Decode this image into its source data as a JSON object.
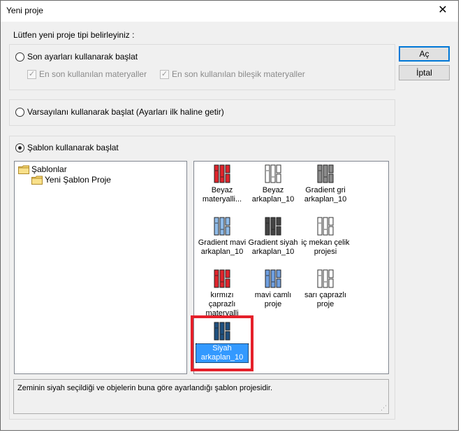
{
  "window": {
    "title": "Yeni proje",
    "close_glyph": "✕"
  },
  "prompt": "Lütfen yeni proje tipi belirleyiniz :",
  "option_recent": {
    "label": "Son ayarları kullanarak başlat",
    "checked": false,
    "checkbox_materials": "En son kullanılan materyaller",
    "checkbox_composite": "En son kullanılan bileşik materyaller"
  },
  "option_default": {
    "label": "Varsayılanı kullanarak başlat (Ayarları ilk haline getir)",
    "checked": false
  },
  "option_template": {
    "label": "Şablon kullanarak başlat",
    "checked": true
  },
  "buttons": {
    "ok": "Aç",
    "cancel": "İptal"
  },
  "tree": {
    "root": "Şablonlar",
    "child": "Yeni Şablon Proje"
  },
  "templates": [
    {
      "label1": "Beyaz",
      "label2": "materyalli...",
      "icon": "red-template-icon",
      "color": "#e0242c",
      "selected": false
    },
    {
      "label1": "Beyaz",
      "label2": "arkaplan_10",
      "icon": "white-template-icon",
      "color": "#ffffff",
      "selected": false
    },
    {
      "label1": "Gradient gri",
      "label2": "arkaplan_10",
      "icon": "gray-template-icon",
      "color": "#8c8c8c",
      "selected": false
    },
    {
      "label1": "Gradient mavi",
      "label2": "arkaplan_10",
      "icon": "lightblue-template-icon",
      "color": "#8fbbe8",
      "selected": false
    },
    {
      "label1": "Gradient siyah",
      "label2": "arkaplan_10",
      "icon": "black-template-icon",
      "color": "#444444",
      "selected": false
    },
    {
      "label1": "iç mekan çelik",
      "label2": "projesi",
      "icon": "white-template-icon",
      "color": "#ffffff",
      "selected": false
    },
    {
      "label1": "kırmızı çaprazlı",
      "label2": "materyalli",
      "icon": "red-template-icon",
      "color": "#e0242c",
      "selected": false
    },
    {
      "label1": "mavi camlı",
      "label2": "proje",
      "icon": "blue-template-icon",
      "color": "#6f9fe0",
      "selected": false
    },
    {
      "label1": "sarı çaprazlı",
      "label2": "proje",
      "icon": "white-template-icon",
      "color": "#ffffff",
      "selected": false
    },
    {
      "label1": "Siyah",
      "label2": "arkaplan_10",
      "icon": "darkblue-template-icon",
      "color": "#1f5080",
      "selected": true
    }
  ],
  "description": "Zeminin siyah seçildiği ve objelerin buna göre ayarlandığı şablon projesidir.",
  "colors": {
    "selection": "#3399ff",
    "highlight": "#e5202a",
    "accent": "#0078d7"
  }
}
